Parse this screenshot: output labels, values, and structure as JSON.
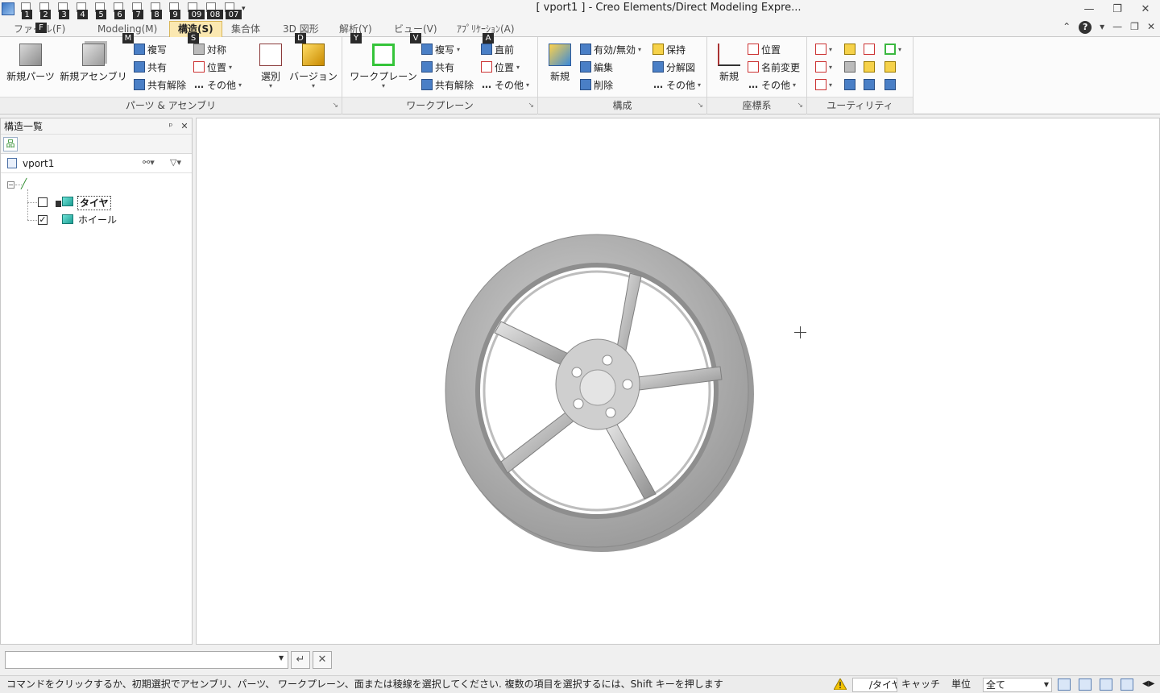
{
  "window": {
    "title": "[ vport1 ] - Creo Elements/Direct Modeling Expre...",
    "controls": {
      "minimize": "—",
      "restore": "❐",
      "close": "✕"
    }
  },
  "quick_access": [
    {
      "key": "1"
    },
    {
      "key": "2"
    },
    {
      "key": "3"
    },
    {
      "key": "4"
    },
    {
      "key": "5"
    },
    {
      "key": "6"
    },
    {
      "key": "7"
    },
    {
      "key": "8"
    },
    {
      "key": "9"
    },
    {
      "key": "09"
    },
    {
      "key": "08"
    },
    {
      "key": "07"
    }
  ],
  "tabs": [
    {
      "label": "ファイル(F)",
      "keytip": "F"
    },
    {
      "label": "Modeling(M)",
      "keytip": "M"
    },
    {
      "label": "構造(S)",
      "keytip": "S",
      "active": true
    },
    {
      "label": "集合体",
      "keytip": ""
    },
    {
      "label": "3D 図形",
      "keytip": "D"
    },
    {
      "label": "解析(Y)",
      "keytip": "Y"
    },
    {
      "label": "ビュー(V)",
      "keytip": "V"
    },
    {
      "label": "ｱﾌﾟﾘｹｰｼｮﾝ(A)",
      "keytip": "A"
    }
  ],
  "ribbon": {
    "parts": {
      "label": "パーツ & アセンブリ",
      "new_part": "新規パーツ",
      "new_assembly": "新規アセンブリ",
      "copy": "複写",
      "share": "共有",
      "unshare": "共有解除",
      "symmetry": "対称",
      "position": "位置",
      "other": "その他"
    },
    "select": {
      "select": "選別",
      "version": "バージョン"
    },
    "workplane": {
      "label": "ワークプレーン",
      "workplane": "ワークプレーン",
      "copy": "複写",
      "share": "共有",
      "unshare": "共有解除",
      "direct": "直前",
      "position": "位置",
      "other": "その他"
    },
    "config": {
      "label": "構成",
      "new": "新規",
      "toggle": "有効/無効",
      "edit": "編集",
      "delete": "削除",
      "keep": "保持",
      "exploded": "分解図",
      "other": "その他"
    },
    "coords": {
      "label": "座標系",
      "new": "新規",
      "position": "位置",
      "rename": "名前変更",
      "other": "その他"
    },
    "utility": {
      "label": "ユーティリティ"
    }
  },
  "structure_panel": {
    "title": "構造一覧",
    "pin": "ᵖ",
    "close": "✕",
    "root": "vport1",
    "items": [
      {
        "label": "タイヤ",
        "checked": false,
        "selected": true
      },
      {
        "label": "ホイール",
        "checked": true,
        "selected": false
      }
    ]
  },
  "command_line": {
    "value": "",
    "enter": "↵",
    "cancel": "✕"
  },
  "status": {
    "message": "コマンドをクリックするか、初期選択でアセンブリ、パーツ、 ワークプレーン、面または稜線を選択してください. 複数の項目を選択するには、Shift キーを押します",
    "field": "/タイヤ",
    "catch": "キャッチ",
    "units": "単位",
    "units_value": "全て"
  },
  "colors": {
    "active_tab": "#fbe8b1",
    "viewport_bg": "#ffffff",
    "wheel_metal": "#b9b9b9"
  }
}
